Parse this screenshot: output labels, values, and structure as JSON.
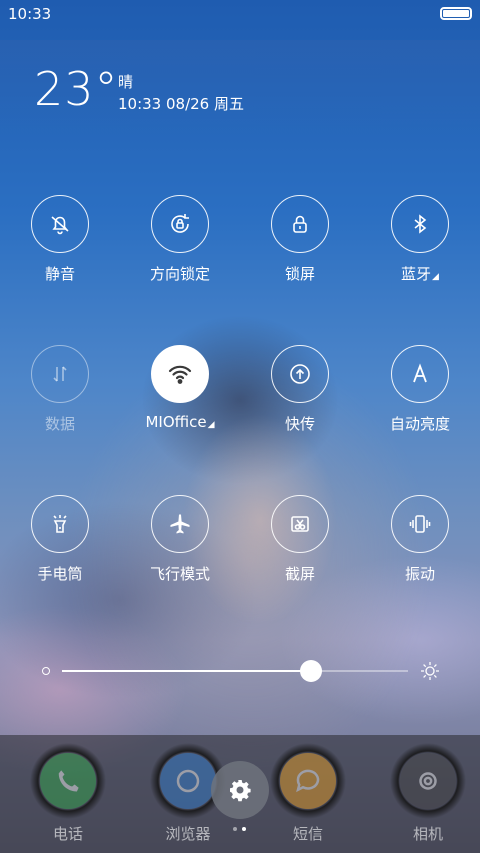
{
  "status": {
    "time": "10:33",
    "battery_level": 1.0
  },
  "weather": {
    "temperature": "23°",
    "condition": "晴",
    "datetime": "10:33 08/26 周五"
  },
  "toggles": [
    {
      "label": "静音",
      "icon": "mute-bell-icon",
      "state": "off"
    },
    {
      "label": "方向锁定",
      "icon": "rotation-lock-icon",
      "state": "off"
    },
    {
      "label": "锁屏",
      "icon": "lock-icon",
      "state": "off"
    },
    {
      "label": "蓝牙",
      "icon": "bluetooth-icon",
      "state": "off",
      "expandable": true
    },
    {
      "label": "数据",
      "icon": "mobile-data-icon",
      "state": "disabled"
    },
    {
      "label": "MIOffice",
      "icon": "wifi-icon",
      "state": "on",
      "expandable": true
    },
    {
      "label": "快传",
      "icon": "quick-transfer-icon",
      "state": "off"
    },
    {
      "label": "自动亮度",
      "icon": "auto-brightness-icon",
      "state": "off"
    },
    {
      "label": "手电筒",
      "icon": "flashlight-icon",
      "state": "off"
    },
    {
      "label": "飞行模式",
      "icon": "airplane-icon",
      "state": "off"
    },
    {
      "label": "截屏",
      "icon": "screenshot-icon",
      "state": "off"
    },
    {
      "label": "振动",
      "icon": "vibrate-icon",
      "state": "off"
    }
  ],
  "brightness": {
    "level": 0.72
  },
  "dock": {
    "apps": [
      {
        "label": "电话",
        "icon": "phone-icon",
        "color": "#2fae4a"
      },
      {
        "label": "浏览器",
        "icon": "browser-icon",
        "color": "#2f7fd6"
      },
      {
        "label": "短信",
        "icon": "message-icon",
        "color": "#f2a21d"
      },
      {
        "label": "相机",
        "icon": "camera-icon",
        "color": "#444444"
      }
    ],
    "settings_icon": "gear-icon",
    "page_count": 2,
    "current_page": 2
  },
  "colors": {
    "accent": "#ffffff",
    "wifi_active_icon": "#3a3a3a"
  }
}
